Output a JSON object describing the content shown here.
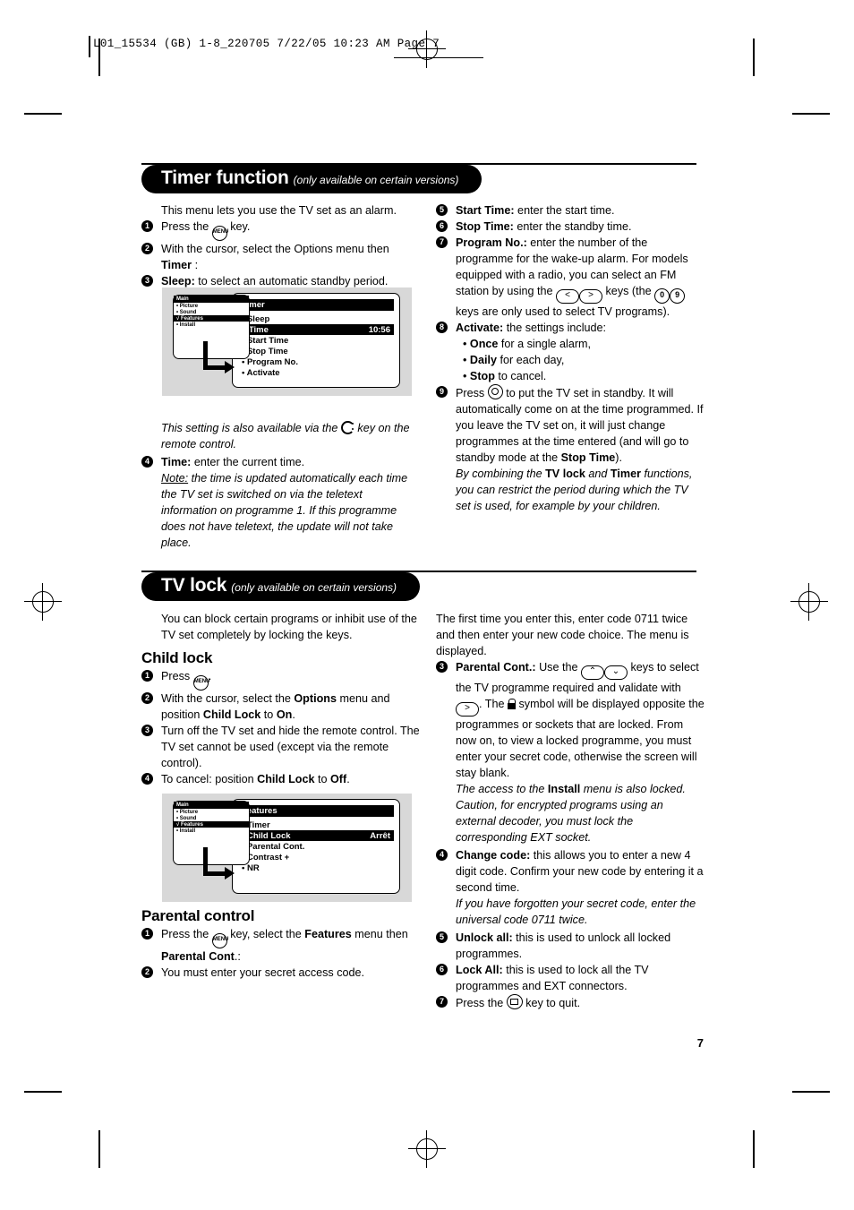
{
  "print_slug": "L01_15534 (GB) 1-8_220705  7/22/05  10:23 AM  Page 7",
  "page_number": "7",
  "sections": [
    {
      "id": "timer",
      "title": "Timer function",
      "subtitle": "(only available on certain versions)",
      "left": {
        "lead": "This menu lets you use the TV set as an alarm.",
        "steps": [
          {
            "num": "1",
            "pre": "Press the ",
            "key": "menu-key",
            "post": " key."
          },
          {
            "num": "2",
            "pre": "With the cursor, select the Options menu then ",
            "bold": "Timer",
            "post": " :"
          },
          {
            "num": "3",
            "bold": "Sleep:",
            "post": " to select an automatic standby period."
          }
        ],
        "after_osd_note": "This setting is also available via the ",
        "after_osd_note_2": " key on the remote control.",
        "steps2": [
          {
            "num": "4",
            "bold": "Time:",
            "post": " enter the current time."
          }
        ],
        "note_label": "Note:",
        "note_text": " the time is updated automatically each time the TV set is switched on via the teletext information on programme 1. If this programme does not have teletext, the update will not take place."
      },
      "right": {
        "steps": [
          {
            "num": "5",
            "bold": "Start Time:",
            "post": " enter the start time."
          },
          {
            "num": "6",
            "bold": "Stop Time:",
            "post": " enter the standby time."
          },
          {
            "num": "7",
            "bold": "Program No.:",
            "post": " enter the number of the programme for the wake-up alarm. For models equipped with a radio, you can select an FM station by using the "
          },
          {
            "num": "8",
            "bold": "Activate:",
            "post": " the settings include:"
          },
          {
            "num": "9",
            "pre": "Press ",
            "post": " to put the TV set in standby. It will automatically come on at the time programmed. If you leave the TV set on, it will just change programmes at the time entered (and will go to standby mode at the "
          }
        ],
        "prog_keys_tail_a": " keys (the ",
        "prog_keys_tail_b": " keys are only used to select TV programs).",
        "key_left": "<",
        "key_right": ">",
        "key_zero": "0",
        "key_nine": "9",
        "activate_options": [
          {
            "bold": "Once",
            "rest": " for a single alarm,"
          },
          {
            "bold": "Daily",
            "rest": " for each day,"
          },
          {
            "bold": "Stop",
            "rest": " to cancel."
          }
        ],
        "stop_time_bold": "Stop Time",
        "stop_time_tail": ").",
        "closing_italic_1": "By combining the ",
        "closing_bold_1": "TV lock",
        "closing_italic_2": " and ",
        "closing_bold_2": "Timer",
        "closing_italic_3": " functions, you can restrict the period during which the TV set is used, for example by your children."
      },
      "osd": {
        "left_header": "Main",
        "left_items": [
          "• Picture",
          "• Sound",
          "√ Features",
          "• Install"
        ],
        "left_selected_index": 2,
        "right_header": "Timer",
        "right_items": [
          {
            "label": "• Sleep",
            "value": ""
          },
          {
            "label": "√ Time",
            "value": "10:56"
          },
          {
            "label": "• Start Time",
            "value": ""
          },
          {
            "label": "• Stop Time",
            "value": ""
          },
          {
            "label": "• Program No.",
            "value": ""
          },
          {
            "label": "• Activate",
            "value": ""
          }
        ],
        "right_selected_index": 1
      }
    },
    {
      "id": "tvlock",
      "title": "TV lock",
      "subtitle": "(only available on certain versions)",
      "left": {
        "lead": "You can block certain programs or inhibit use of the TV set completely by locking the keys.",
        "subhead_1": "Child lock",
        "steps": [
          {
            "num": "1",
            "pre": "Press ",
            "key": "menu-key",
            "post": "."
          },
          {
            "num": "2",
            "pre": "With the cursor, select the ",
            "bold": "Options",
            "post": " menu and position ",
            "bold2": "Child Lock",
            "post2": " to ",
            "bold3": "On",
            "post3": "."
          },
          {
            "num": "3",
            "post": "Turn off the TV set and hide the remote control. The TV set cannot be used (except via the remote control)."
          },
          {
            "num": "4",
            "pre": "To cancel: position ",
            "bold": "Child Lock",
            "post": " to ",
            "bold2": "Off",
            "post2": "."
          }
        ],
        "subhead_2": "Parental control",
        "steps2": [
          {
            "num": "1",
            "pre": "Press the ",
            "key": "menu-key",
            "post": " key, select the ",
            "bold": "Features",
            "post2": " menu then ",
            "bold2": "Parental Cont",
            "post3": ".:"
          },
          {
            "num": "2",
            "post": "You must enter your secret access code."
          }
        ]
      },
      "right": {
        "lead": "The first time you enter this, enter code 0711 twice and then enter your new code choice. The menu is displayed.",
        "steps": [
          {
            "num": "3",
            "bold": "Parental Cont.:",
            "post": " Use the "
          },
          {
            "num": "4",
            "bold": "Change code:",
            "post": " this allows you to enter a new 4 digit code. Confirm your new code by entering it a second time."
          },
          {
            "num": "5",
            "bold": "Unlock all:",
            "post": " this is used to unlock all locked programmes."
          },
          {
            "num": "6",
            "bold": "Lock All:",
            "post": " this is used to lock all the TV programmes and EXT connectors."
          },
          {
            "num": "7",
            "pre": "Press the ",
            "post": " key to quit."
          }
        ],
        "parental_tail_a": " keys to select the TV programme required and validate with ",
        "parental_tail_b": ". The ",
        "parental_tail_c": " symbol will be displayed opposite the programmes or sockets that are locked. From now on, to view a locked programme, you must enter your secret code, otherwise the screen will stay blank.",
        "key_up": "⌃",
        "key_down": "⌄",
        "key_right": ">",
        "italic_note_1": "The access to the ",
        "italic_bold_1": "Install",
        "italic_note_2": " menu is also locked. Caution, for encrypted programs using an external decoder, you must lock the corresponding EXT socket.",
        "italic_note_3": "If you have forgotten your secret code, enter the universal code 0711 twice."
      },
      "osd": {
        "left_header": "Main",
        "left_items": [
          "• Picture",
          "• Sound",
          "√ Features",
          "• Install"
        ],
        "left_selected_index": 2,
        "right_header": "Features",
        "right_items": [
          {
            "label": "• Timer",
            "value": ""
          },
          {
            "label": "• Child Lock",
            "value": "Arrêt"
          },
          {
            "label": "• Parental Cont.",
            "value": ""
          },
          {
            "label": "• Contrast +",
            "value": ""
          },
          {
            "label": "• NR",
            "value": ""
          }
        ],
        "right_selected_index": 1
      }
    }
  ],
  "icons": {
    "menu_key_label": "MENU",
    "clock_key": "clock-key-icon",
    "standby_key": "standby-key-icon",
    "tv_key": "tv-key-icon",
    "lock_symbol": "padlock-icon"
  }
}
